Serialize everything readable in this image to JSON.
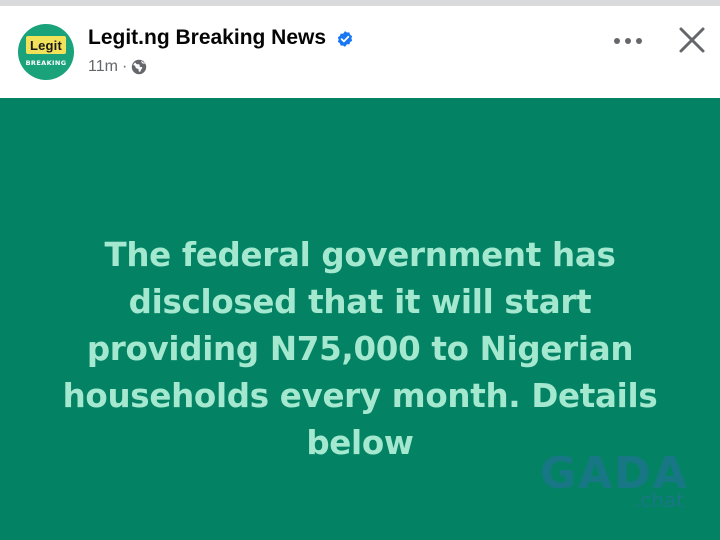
{
  "header": {
    "page_name": "Legit.ng Breaking News",
    "timestamp": "11m",
    "separator": "·",
    "privacy_icon": "globe-icon",
    "verified_icon": "verified-badge-icon",
    "more_icon": "more-options-icon",
    "close_icon": "close-icon"
  },
  "avatar": {
    "logo_text": "Legit",
    "logo_subtext": "BREAKING"
  },
  "post": {
    "text": "The federal government has disclosed that it will start providing N75,000 to Nigerian households every month. Details below",
    "background_color": "#048264",
    "text_color": "#a3e8cf"
  },
  "watermark": {
    "main": "GADA",
    "sub": ".chat"
  },
  "colors": {
    "verified_blue": "#1877f2",
    "icon_gray": "#65676b",
    "avatar_green": "#1aa37a",
    "logo_yellow": "#f2e25a"
  }
}
